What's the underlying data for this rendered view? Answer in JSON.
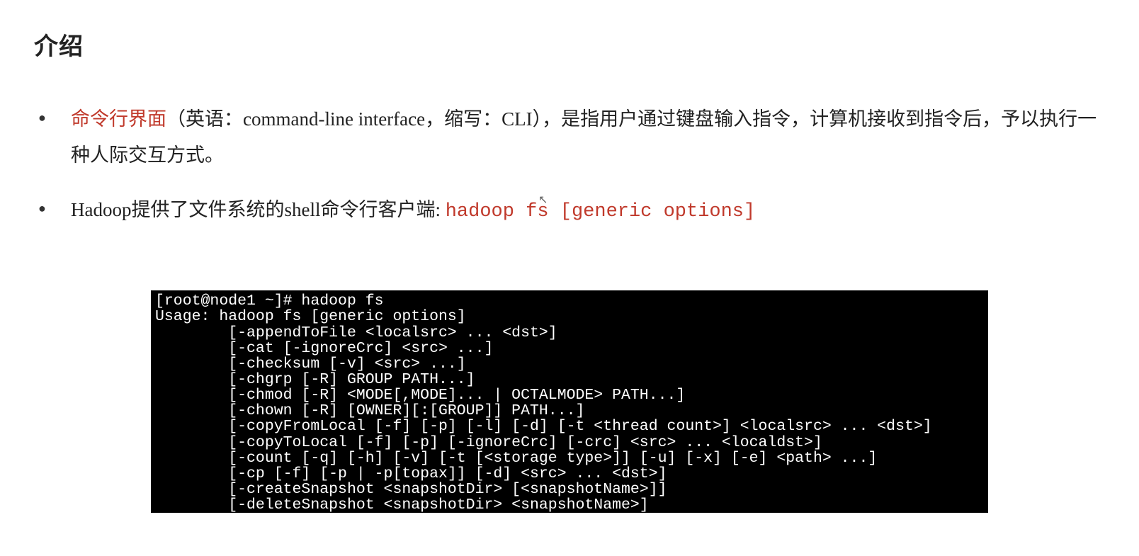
{
  "heading": "介绍",
  "bullets": {
    "item1": {
      "red": "命令行界面",
      "rest": "（英语：command-line interface，缩写：CLI），是指用户通过键盘输入指令，计算机接收到指令后，予以执行一种人际交互方式。"
    },
    "item2": {
      "pre": "Hadoop提供了文件系统的shell命令行客户端: ",
      "cmd": "hadoop fs [generic options]"
    }
  },
  "terminal": {
    "prompt": "[root@node1 ~]# hadoop fs",
    "usage": "Usage: hadoop fs [generic options]",
    "l01": "        [-appendToFile <localsrc> ... <dst>]",
    "l02": "        [-cat [-ignoreCrc] <src> ...]",
    "l03": "        [-checksum [-v] <src> ...]",
    "l04": "        [-chgrp [-R] GROUP PATH...]",
    "l05": "        [-chmod [-R] <MODE[,MODE]... | OCTALMODE> PATH...]",
    "l06": "        [-chown [-R] [OWNER][:[GROUP]] PATH...]",
    "l07": "        [-copyFromLocal [-f] [-p] [-l] [-d] [-t <thread count>] <localsrc> ... <dst>]",
    "l08": "        [-copyToLocal [-f] [-p] [-ignoreCrc] [-crc] <src> ... <localdst>]",
    "l09": "        [-count [-q] [-h] [-v] [-t [<storage type>]] [-u] [-x] [-e] <path> ...]",
    "l10": "        [-cp [-f] [-p | -p[topax]] [-d] <src> ... <dst>]",
    "l11": "        [-createSnapshot <snapshotDir> [<snapshotName>]]",
    "l12": "        [-deleteSnapshot <snapshotDir> <snapshotName>]"
  },
  "cursor_glyph": "↖"
}
